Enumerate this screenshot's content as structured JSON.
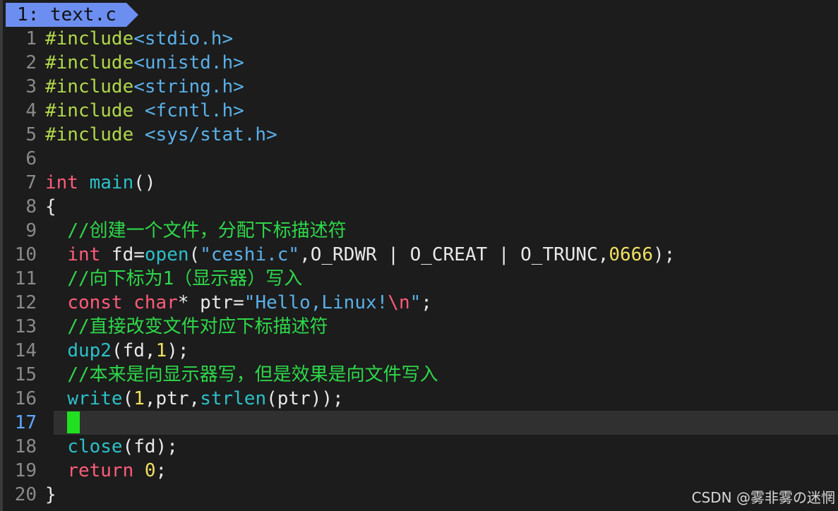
{
  "tabline": {
    "tab_label": "1: text.c"
  },
  "watermark": "CSDN @雾非雾の迷惘",
  "colors": {
    "background": "#1c1c1c",
    "tab": "#6c8ef0",
    "cursor": "#20e020",
    "cursorline": "#303030"
  },
  "editor": {
    "current_line": 17,
    "lines": [
      {
        "num": "1",
        "tokens": [
          {
            "t": "#include",
            "c": "pre"
          },
          {
            "t": "<stdio.h>",
            "c": "inc"
          }
        ]
      },
      {
        "num": "2",
        "tokens": [
          {
            "t": "#include",
            "c": "pre"
          },
          {
            "t": "<unistd.h>",
            "c": "inc"
          }
        ]
      },
      {
        "num": "3",
        "tokens": [
          {
            "t": "#include",
            "c": "pre"
          },
          {
            "t": "<string.h>",
            "c": "inc"
          }
        ]
      },
      {
        "num": "4",
        "tokens": [
          {
            "t": "#include ",
            "c": "pre"
          },
          {
            "t": "<fcntl.h>",
            "c": "inc"
          }
        ]
      },
      {
        "num": "5",
        "tokens": [
          {
            "t": "#include ",
            "c": "pre"
          },
          {
            "t": "<sys/stat.h>",
            "c": "inc"
          }
        ]
      },
      {
        "num": "6",
        "tokens": []
      },
      {
        "num": "7",
        "tokens": [
          {
            "t": "int",
            "c": "type"
          },
          {
            "t": " ",
            "c": "plain"
          },
          {
            "t": "main",
            "c": "func"
          },
          {
            "t": "()",
            "c": "plain"
          }
        ]
      },
      {
        "num": "8",
        "tokens": [
          {
            "t": "{",
            "c": "plain"
          }
        ]
      },
      {
        "num": "9",
        "tokens": [
          {
            "t": "  ",
            "c": "plain"
          },
          {
            "t": "//创建一个文件，分配下标描述符",
            "c": "com"
          }
        ]
      },
      {
        "num": "10",
        "tokens": [
          {
            "t": "  ",
            "c": "plain"
          },
          {
            "t": "int",
            "c": "type"
          },
          {
            "t": " fd=",
            "c": "plain"
          },
          {
            "t": "open",
            "c": "func"
          },
          {
            "t": "(",
            "c": "plain"
          },
          {
            "t": "\"ceshi.c\"",
            "c": "str"
          },
          {
            "t": ",O_RDWR | O_CREAT | O_TRUNC,",
            "c": "plain"
          },
          {
            "t": "0666",
            "c": "num"
          },
          {
            "t": ");",
            "c": "plain"
          }
        ]
      },
      {
        "num": "11",
        "tokens": [
          {
            "t": "  ",
            "c": "plain"
          },
          {
            "t": "//向下标为1（显示器）写入",
            "c": "com"
          }
        ]
      },
      {
        "num": "12",
        "tokens": [
          {
            "t": "  ",
            "c": "plain"
          },
          {
            "t": "const",
            "c": "type"
          },
          {
            "t": " ",
            "c": "plain"
          },
          {
            "t": "char",
            "c": "type"
          },
          {
            "t": "* ptr=",
            "c": "plain"
          },
          {
            "t": "\"Hello,Linux!",
            "c": "str"
          },
          {
            "t": "\\n",
            "c": "esc"
          },
          {
            "t": "\"",
            "c": "str"
          },
          {
            "t": ";",
            "c": "plain"
          }
        ]
      },
      {
        "num": "13",
        "tokens": [
          {
            "t": "  ",
            "c": "plain"
          },
          {
            "t": "//直接改变文件对应下标描述符",
            "c": "com"
          }
        ]
      },
      {
        "num": "14",
        "tokens": [
          {
            "t": "  ",
            "c": "plain"
          },
          {
            "t": "dup2",
            "c": "func"
          },
          {
            "t": "(fd,",
            "c": "plain"
          },
          {
            "t": "1",
            "c": "num"
          },
          {
            "t": ");",
            "c": "plain"
          }
        ]
      },
      {
        "num": "15",
        "tokens": [
          {
            "t": "  ",
            "c": "plain"
          },
          {
            "t": "//本来是向显示器写，但是效果是向文件写入",
            "c": "com"
          }
        ]
      },
      {
        "num": "16",
        "tokens": [
          {
            "t": "  ",
            "c": "plain"
          },
          {
            "t": "write",
            "c": "func"
          },
          {
            "t": "(",
            "c": "plain"
          },
          {
            "t": "1",
            "c": "num"
          },
          {
            "t": ",ptr,",
            "c": "plain"
          },
          {
            "t": "strlen",
            "c": "func"
          },
          {
            "t": "(ptr));",
            "c": "plain"
          }
        ]
      },
      {
        "num": "17",
        "tokens": [
          {
            "t": "  ",
            "c": "plain"
          }
        ],
        "cursor": true
      },
      {
        "num": "18",
        "tokens": [
          {
            "t": "  ",
            "c": "plain"
          },
          {
            "t": "close",
            "c": "func"
          },
          {
            "t": "(fd);",
            "c": "plain"
          }
        ]
      },
      {
        "num": "19",
        "tokens": [
          {
            "t": "  ",
            "c": "plain"
          },
          {
            "t": "return",
            "c": "type"
          },
          {
            "t": " ",
            "c": "plain"
          },
          {
            "t": "0",
            "c": "num"
          },
          {
            "t": ";",
            "c": "plain"
          }
        ]
      },
      {
        "num": "20",
        "tokens": [
          {
            "t": "}",
            "c": "plain"
          }
        ]
      }
    ]
  }
}
